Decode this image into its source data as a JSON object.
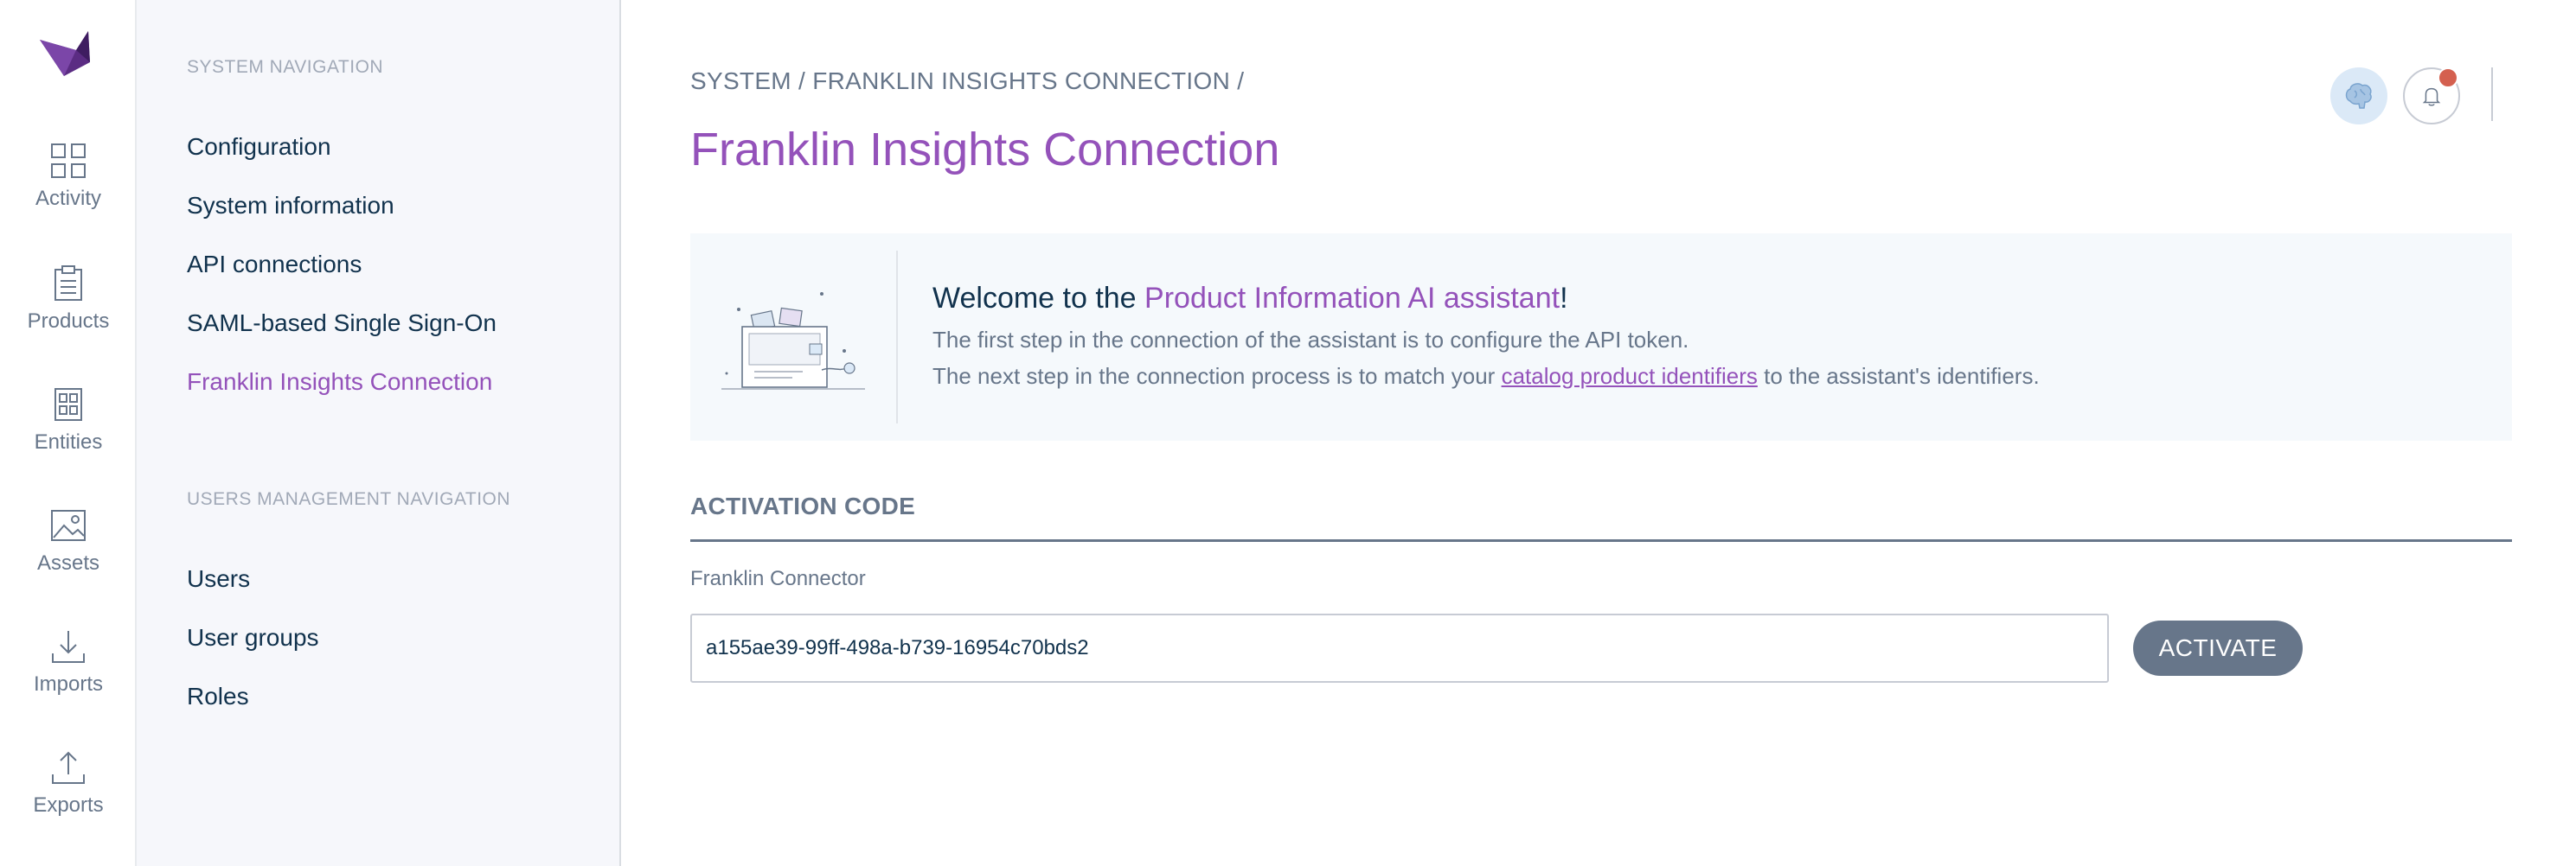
{
  "rail": {
    "items": [
      {
        "label": "Activity",
        "icon": "dashboard-icon"
      },
      {
        "label": "Products",
        "icon": "clipboard-icon"
      },
      {
        "label": "Entities",
        "icon": "entities-icon"
      },
      {
        "label": "Assets",
        "icon": "image-icon"
      },
      {
        "label": "Imports",
        "icon": "import-icon"
      },
      {
        "label": "Exports",
        "icon": "export-icon"
      }
    ]
  },
  "subnav": {
    "system_section": "SYSTEM NAVIGATION",
    "system_items": [
      {
        "label": "Configuration"
      },
      {
        "label": "System information"
      },
      {
        "label": "API connections"
      },
      {
        "label": "SAML-based Single Sign-On"
      },
      {
        "label": "Franklin Insights Connection"
      }
    ],
    "users_section": "USERS MANAGEMENT NAVIGATION",
    "users_items": [
      {
        "label": "Users"
      },
      {
        "label": "User groups"
      },
      {
        "label": "Roles"
      }
    ]
  },
  "header": {
    "breadcrumb_root": "SYSTEM",
    "breadcrumb_sep": "/",
    "breadcrumb_current": "FRANKLIN INSIGHTS CONNECTION",
    "title": "Franklin Insights Connection"
  },
  "helper": {
    "title_prefix": "Welcome to the ",
    "title_accent": "Product Information AI assistant",
    "title_suffix": "!",
    "line1": "The first step in the connection of the assistant is to configure the API token.",
    "line2_prefix": "The next step in the connection process is to match your ",
    "line2_link": "catalog product identifiers",
    "line2_suffix": " to the assistant's identifiers."
  },
  "activation": {
    "section_title": "ACTIVATION CODE",
    "field_label": "Franklin Connector",
    "field_value": "a155ae39-99ff-498a-b739-16954c70bds2",
    "button_label": "ACTIVATE"
  },
  "colors": {
    "accent": "#9452ba",
    "text": "#11324d",
    "muted": "#67768a",
    "notification": "#d4604f"
  }
}
